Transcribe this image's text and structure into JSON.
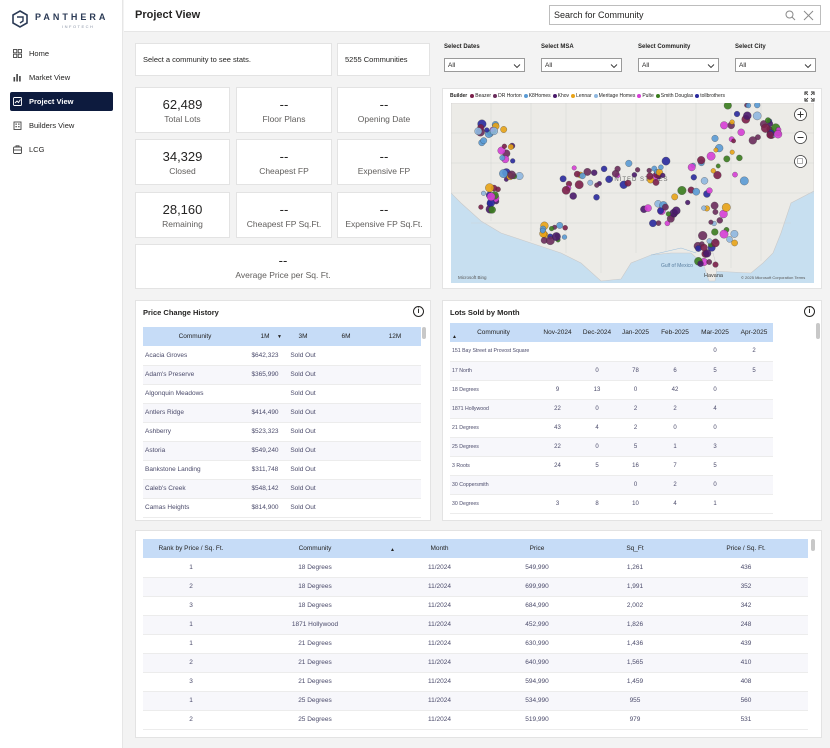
{
  "brand": {
    "name": "PANTHERA",
    "sub": "INFOTECH"
  },
  "nav": [
    {
      "label": "Home",
      "icon": "home-icon"
    },
    {
      "label": "Market View",
      "icon": "market-icon"
    },
    {
      "label": "Project View",
      "icon": "project-icon",
      "active": true
    },
    {
      "label": "Builders View",
      "icon": "builders-icon"
    },
    {
      "label": "LCG",
      "icon": "lcg-icon"
    }
  ],
  "header": {
    "title": "Project View",
    "search_placeholder": "Search for Community"
  },
  "status": {
    "message": "Select a community to see stats.",
    "communities": "5255 Communities"
  },
  "filters": [
    {
      "label": "Select Dates",
      "value": "All"
    },
    {
      "label": "Select MSA",
      "value": "All"
    },
    {
      "label": "Select Community",
      "value": "All"
    },
    {
      "label": "Select City",
      "value": "All"
    }
  ],
  "kpis": {
    "total_lots": {
      "value": "62,489",
      "label": "Total Lots"
    },
    "floor_plans": {
      "value": "--",
      "label": "Floor Plans"
    },
    "opening_date": {
      "value": "--",
      "label": "Opening Date"
    },
    "closed": {
      "value": "34,329",
      "label": "Closed"
    },
    "cheapest_fp": {
      "value": "--",
      "label": "Cheapest FP"
    },
    "expensive_fp": {
      "value": "--",
      "label": "Expensive FP"
    },
    "remaining": {
      "value": "28,160",
      "label": "Remaining"
    },
    "cheapest_sqft": {
      "value": "--",
      "label": "Cheapest FP Sq.Ft."
    },
    "expensive_sqft": {
      "value": "--",
      "label": "Expensive FP Sq.Ft."
    },
    "avg_price_sqft": {
      "value": "--",
      "label": "Average Price per Sq. Ft."
    }
  },
  "map": {
    "legend_title": "Builder",
    "builders": [
      {
        "name": "Beazer",
        "color": "#7b1f4a"
      },
      {
        "name": "DR Horton",
        "color": "#6b2d5c"
      },
      {
        "name": "K8Homes",
        "color": "#5a9bd5"
      },
      {
        "name": "Khov",
        "color": "#4a1a6b"
      },
      {
        "name": "Lennar",
        "color": "#e8a317"
      },
      {
        "name": "Meritage Homes",
        "color": "#8fb8e0"
      },
      {
        "name": "Pulte",
        "color": "#d63fd6"
      },
      {
        "name": "Smith Douglas",
        "color": "#3a7d1e"
      },
      {
        "name": "tollbrothers",
        "color": "#2a2a9e"
      }
    ],
    "labels": {
      "country": "UNITED STATES",
      "gulf": "Gulf of Mexico",
      "city": "Havana"
    },
    "attribution": "© 2025 Microsoft Corporation  Terms",
    "provider": "Microsoft Bing"
  },
  "price_history": {
    "title": "Price Change History",
    "columns": [
      "Community",
      "1M",
      "3M",
      "6M",
      "12M"
    ],
    "rows": [
      [
        "Acacia Groves",
        "$642,323",
        "Sold Out"
      ],
      [
        "Adam's Preserve",
        "$365,990",
        "Sold Out"
      ],
      [
        "Algonquin Meadows",
        "",
        "Sold Out"
      ],
      [
        "Antlers Ridge",
        "$414,490",
        "Sold Out"
      ],
      [
        "Ashberry",
        "$523,323",
        "Sold Out"
      ],
      [
        "Astoria",
        "$549,240",
        "Sold Out"
      ],
      [
        "Bankstone Landing",
        "$311,748",
        "Sold Out"
      ],
      [
        "Caleb's Creek",
        "$548,142",
        "Sold Out"
      ],
      [
        "Camas Heights",
        "$814,900",
        "Sold Out"
      ]
    ]
  },
  "lots_sold": {
    "title": "Lots Sold by Month",
    "columns": [
      "Community",
      "Nov-2024",
      "Dec-2024",
      "Jan-2025",
      "Feb-2025",
      "Mar-2025",
      "Apr-2025"
    ],
    "rows": [
      [
        "151 Bay Street at Provost Square",
        "",
        "",
        "",
        "",
        "0",
        "2"
      ],
      [
        "17 North",
        "",
        "0",
        "78",
        "6",
        "5",
        "5"
      ],
      [
        "18 Degrees",
        "9",
        "13",
        "0",
        "42",
        "0",
        ""
      ],
      [
        "1871 Hollywood",
        "22",
        "0",
        "2",
        "2",
        "4",
        ""
      ],
      [
        "21 Degrees",
        "43",
        "4",
        "2",
        "0",
        "0",
        ""
      ],
      [
        "25 Degrees",
        "22",
        "0",
        "5",
        "1",
        "3",
        ""
      ],
      [
        "3 Roots",
        "24",
        "5",
        "16",
        "7",
        "5",
        ""
      ],
      [
        "30 Coppersmith",
        "",
        "",
        "0",
        "2",
        "0",
        ""
      ],
      [
        "30 Degrees",
        "3",
        "8",
        "10",
        "4",
        "1",
        ""
      ]
    ]
  },
  "rank": {
    "columns": [
      "Rank by Price / Sq. Ft.",
      "Community",
      "Month",
      "Price",
      "Sq_Ft",
      "Price / Sq. Ft."
    ],
    "rows": [
      [
        "1",
        "18 Degrees",
        "11/2024",
        "549,990",
        "1,261",
        "436"
      ],
      [
        "2",
        "18 Degrees",
        "11/2024",
        "699,990",
        "1,991",
        "352"
      ],
      [
        "3",
        "18 Degrees",
        "11/2024",
        "684,990",
        "2,002",
        "342"
      ],
      [
        "1",
        "1871 Hollywood",
        "11/2024",
        "452,990",
        "1,826",
        "248"
      ],
      [
        "1",
        "21 Degrees",
        "11/2024",
        "630,990",
        "1,436",
        "439"
      ],
      [
        "2",
        "21 Degrees",
        "11/2024",
        "640,990",
        "1,565",
        "410"
      ],
      [
        "3",
        "21 Degrees",
        "11/2024",
        "594,990",
        "1,459",
        "408"
      ],
      [
        "1",
        "25 Degrees",
        "11/2024",
        "534,990",
        "955",
        "560"
      ],
      [
        "2",
        "25 Degrees",
        "11/2024",
        "519,990",
        "979",
        "531"
      ]
    ]
  }
}
